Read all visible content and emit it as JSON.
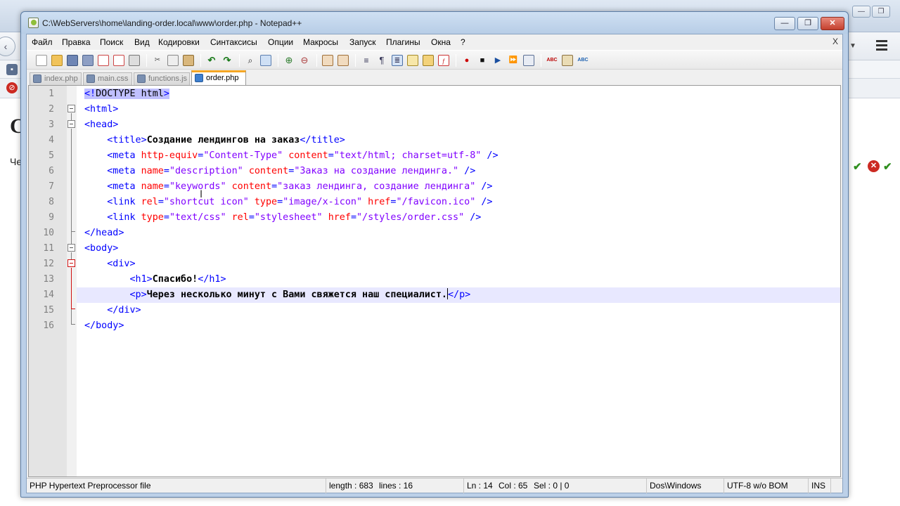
{
  "window": {
    "title": "C:\\WebServers\\home\\landing-order.local\\www\\order.php - Notepad++",
    "minimize": "—",
    "maximize": "❐",
    "close": "✕"
  },
  "menu": {
    "items": [
      "Файл",
      "Правка",
      "Поиск",
      "Вид",
      "Кодировки",
      "Синтаксисы",
      "Опции",
      "Макросы",
      "Запуск",
      "Плагины",
      "Окна",
      "?"
    ],
    "close_doc": "X"
  },
  "tabs": [
    {
      "label": "index.php",
      "active": false
    },
    {
      "label": "main.css",
      "active": false
    },
    {
      "label": "functions.js",
      "active": false
    },
    {
      "label": "order.php",
      "active": true
    }
  ],
  "editor": {
    "current_line": 14,
    "lines": [
      {
        "n": "1",
        "parts": [
          [
            "hl t",
            "<!"
          ],
          [
            "hl dt",
            "DOCTYPE html"
          ],
          [
            "hl t",
            ">"
          ]
        ]
      },
      {
        "n": "2",
        "parts": [
          [
            "t",
            "<html>"
          ]
        ]
      },
      {
        "n": "3",
        "parts": [
          [
            "t",
            "<head>"
          ]
        ]
      },
      {
        "n": "4",
        "parts": [
          [
            "",
            "    "
          ],
          [
            "t",
            "<title>"
          ],
          [
            "x",
            "Создание лендингов на заказ"
          ],
          [
            "t",
            "</title>"
          ]
        ]
      },
      {
        "n": "5",
        "parts": [
          [
            "",
            "    "
          ],
          [
            "t",
            "<meta "
          ],
          [
            "a",
            "http-equiv"
          ],
          [
            "t",
            "="
          ],
          [
            "v",
            "\"Content-Type\""
          ],
          [
            "t",
            " "
          ],
          [
            "a",
            "content"
          ],
          [
            "t",
            "="
          ],
          [
            "v",
            "\"text/html; charset=utf-8\""
          ],
          [
            "t",
            " />"
          ]
        ]
      },
      {
        "n": "6",
        "parts": [
          [
            "",
            "    "
          ],
          [
            "t",
            "<meta "
          ],
          [
            "a",
            "name"
          ],
          [
            "t",
            "="
          ],
          [
            "v",
            "\"description\""
          ],
          [
            "t",
            " "
          ],
          [
            "a",
            "content"
          ],
          [
            "t",
            "="
          ],
          [
            "v",
            "\"Заказ на создание лендинга.\""
          ],
          [
            "t",
            " />"
          ]
        ]
      },
      {
        "n": "7",
        "parts": [
          [
            "",
            "    "
          ],
          [
            "t",
            "<meta "
          ],
          [
            "a",
            "name"
          ],
          [
            "t",
            "="
          ],
          [
            "v",
            "\"keywords\""
          ],
          [
            "t",
            " "
          ],
          [
            "a",
            "content"
          ],
          [
            "t",
            "="
          ],
          [
            "v",
            "\"заказ лендинга, создание лендинга\""
          ],
          [
            "t",
            " />"
          ]
        ]
      },
      {
        "n": "8",
        "parts": [
          [
            "",
            "    "
          ],
          [
            "t",
            "<link "
          ],
          [
            "a",
            "rel"
          ],
          [
            "t",
            "="
          ],
          [
            "v",
            "\"shortcut icon\""
          ],
          [
            "t",
            " "
          ],
          [
            "a",
            "type"
          ],
          [
            "t",
            "="
          ],
          [
            "v",
            "\"image/x-icon\""
          ],
          [
            "t",
            " "
          ],
          [
            "a",
            "href"
          ],
          [
            "t",
            "="
          ],
          [
            "v",
            "\"/favicon.ico\""
          ],
          [
            "t",
            " />"
          ]
        ]
      },
      {
        "n": "9",
        "parts": [
          [
            "",
            "    "
          ],
          [
            "t",
            "<link "
          ],
          [
            "a",
            "type"
          ],
          [
            "t",
            "="
          ],
          [
            "v",
            "\"text/css\""
          ],
          [
            "t",
            " "
          ],
          [
            "a",
            "rel"
          ],
          [
            "t",
            "="
          ],
          [
            "v",
            "\"stylesheet\""
          ],
          [
            "t",
            " "
          ],
          [
            "a",
            "href"
          ],
          [
            "t",
            "="
          ],
          [
            "v",
            "\"/styles/order.css\""
          ],
          [
            "t",
            " />"
          ]
        ]
      },
      {
        "n": "10",
        "parts": [
          [
            "t",
            "</head>"
          ]
        ]
      },
      {
        "n": "11",
        "parts": [
          [
            "t",
            "<body>"
          ]
        ]
      },
      {
        "n": "12",
        "parts": [
          [
            "",
            "    "
          ],
          [
            "t",
            "<div>"
          ]
        ]
      },
      {
        "n": "13",
        "parts": [
          [
            "",
            "        "
          ],
          [
            "t",
            "<h1>"
          ],
          [
            "x",
            "Спасибо!"
          ],
          [
            "t",
            "</h1>"
          ]
        ]
      },
      {
        "n": "14",
        "parts": [
          [
            "",
            "        "
          ],
          [
            "t",
            "<p>"
          ],
          [
            "x",
            "Через несколько минут с Вами свяжется наш специалист."
          ],
          [
            "caret",
            ""
          ],
          [
            "t",
            "</p>"
          ]
        ]
      },
      {
        "n": "15",
        "parts": [
          [
            "",
            "    "
          ],
          [
            "t",
            "</div>"
          ]
        ]
      },
      {
        "n": "16",
        "parts": [
          [
            "t",
            "</body>"
          ]
        ]
      }
    ]
  },
  "status": {
    "file_type": "PHP Hypertext Preprocessor file",
    "length": "length : 683",
    "lines": "lines : 16",
    "ln": "Ln : 14",
    "col": "Col : 65",
    "sel": "Sel : 0 | 0",
    "eol": "Dos\\Windows",
    "encoding": "UTF-8 w/o BOM",
    "mode": "INS"
  },
  "background": {
    "heading_letter": "С",
    "text_fragment": "Че"
  },
  "colors": {
    "tag": "#0000ff",
    "attribute": "#ff0000",
    "value": "#8000ff",
    "current_line": "#e8e8ff",
    "active_tab_accent": "#f5a623"
  }
}
